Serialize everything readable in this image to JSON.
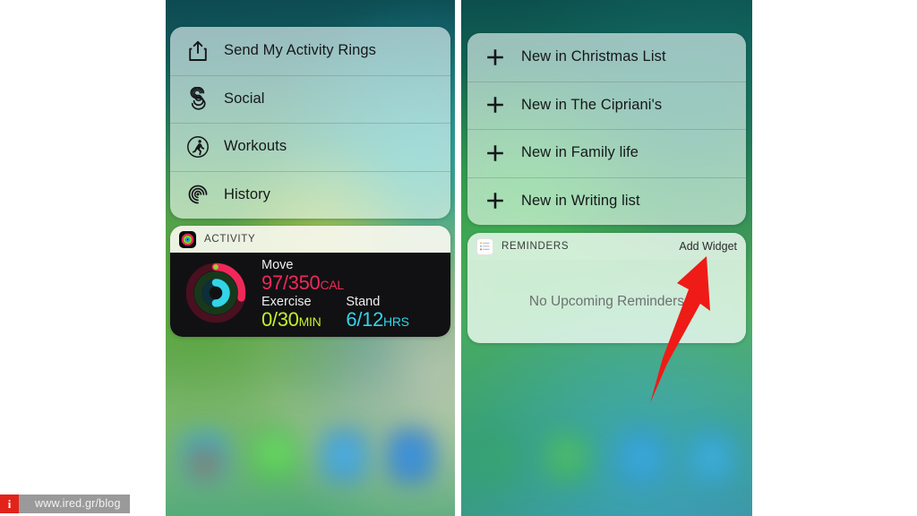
{
  "watermark": {
    "logo": "i",
    "url": "www.ired.gr/blog"
  },
  "left_phone": {
    "name": "activity-3d-touch-screen",
    "shortcut_card": {
      "items": [
        {
          "icon": "share-icon",
          "label": "Send My Activity Rings"
        },
        {
          "icon": "social-icon",
          "label": "Social"
        },
        {
          "icon": "workouts-icon",
          "label": "Workouts"
        },
        {
          "icon": "history-icon",
          "label": "History"
        }
      ]
    },
    "widget": {
      "app_icon": "activity-rings-icon",
      "title": "ACTIVITY",
      "rings": {
        "move": {
          "color": "#f0285a",
          "progress": 0.28
        },
        "exercise": {
          "color": "#c3f02a",
          "progress": 0.0
        },
        "stand": {
          "color": "#32d4e8",
          "progress": 0.5
        }
      },
      "stats": [
        {
          "label": "Move",
          "value": "97/350",
          "unit": "CAL",
          "color": "#f0285a"
        },
        {
          "label": "Exercise",
          "value": "0/30",
          "unit": "MIN",
          "color": "#c3f02a"
        },
        {
          "label": "Stand",
          "value": "6/12",
          "unit": "HRS",
          "color": "#32d4e8"
        }
      ]
    }
  },
  "right_phone": {
    "name": "reminders-3d-touch-screen",
    "shortcut_card": {
      "items": [
        {
          "icon": "plus-icon",
          "label": "New in Christmas List"
        },
        {
          "icon": "plus-icon",
          "label": "New in The Cipriani's"
        },
        {
          "icon": "plus-icon",
          "label": "New in Family life"
        },
        {
          "icon": "plus-icon",
          "label": "New in Writing list"
        }
      ]
    },
    "widget": {
      "app_icon": "reminders-list-icon",
      "title": "REMINDERS",
      "action_label": "Add Widget",
      "empty_state": "No Upcoming Reminders"
    },
    "annotation": {
      "type": "arrow",
      "color": "#ee1b17",
      "points_to": "Add Widget"
    }
  }
}
